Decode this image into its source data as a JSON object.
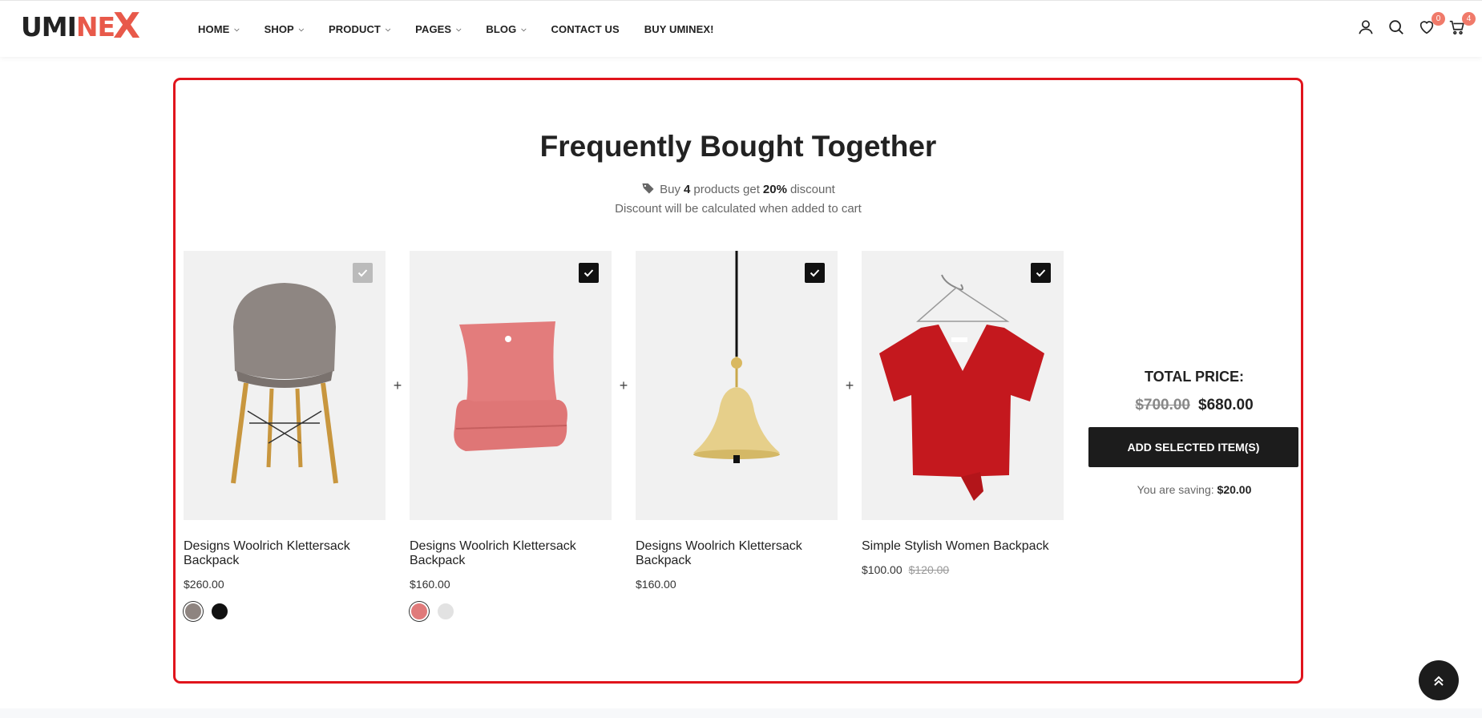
{
  "brand": {
    "logo_text_a": "UMI",
    "logo_text_b": "NE",
    "logo_text_c": "X"
  },
  "nav": [
    {
      "label": "HOME",
      "dropdown": true
    },
    {
      "label": "SHOP",
      "dropdown": true
    },
    {
      "label": "PRODUCT",
      "dropdown": true
    },
    {
      "label": "PAGES",
      "dropdown": true
    },
    {
      "label": "BLOG",
      "dropdown": true
    },
    {
      "label": "CONTACT US",
      "dropdown": false
    },
    {
      "label": "BUY UMINEX!",
      "dropdown": false
    }
  ],
  "header_icons": {
    "account": "user-icon",
    "search": "search-icon",
    "wishlist": "heart-icon",
    "wishlist_count": "0",
    "cart": "cart-icon",
    "cart_count": "4"
  },
  "fbt": {
    "title": "Frequently Bought Together",
    "promo_prefix": "Buy",
    "promo_qty": "4",
    "promo_mid": "products get",
    "promo_discount": "20%",
    "promo_suffix": "discount",
    "promo_sub": "Discount will be calculated when added to cart",
    "products": [
      {
        "name": "Designs Woolrich Klettersack Backpack",
        "price": "$260.00",
        "old_price": "",
        "checked_style": "light",
        "image": "chair",
        "swatches": [
          "#8e8480",
          "#111111"
        ]
      },
      {
        "name": "Designs Woolrich Klettersack Backpack",
        "price": "$160.00",
        "old_price": "",
        "checked_style": "dark",
        "image": "pillow",
        "swatches": [
          "#e07a7a",
          "#e2e2e2"
        ]
      },
      {
        "name": "Designs Woolrich Klettersack Backpack",
        "price": "$160.00",
        "old_price": "",
        "checked_style": "dark",
        "image": "lamp",
        "swatches": []
      },
      {
        "name": "Simple Stylish Women Backpack",
        "price": "$100.00",
        "old_price": "$120.00",
        "checked_style": "dark",
        "image": "shirt",
        "swatches": []
      }
    ],
    "total_label": "TOTAL PRICE:",
    "total_old": "$700.00",
    "total_new": "$680.00",
    "add_button": "ADD SELECTED ITEM(S)",
    "saving_label": "You are saving:",
    "saving_value": "$20.00"
  },
  "colors": {
    "accent": "#e8594a",
    "highlight_border": "#e0141c",
    "button": "#1c1c1c"
  }
}
